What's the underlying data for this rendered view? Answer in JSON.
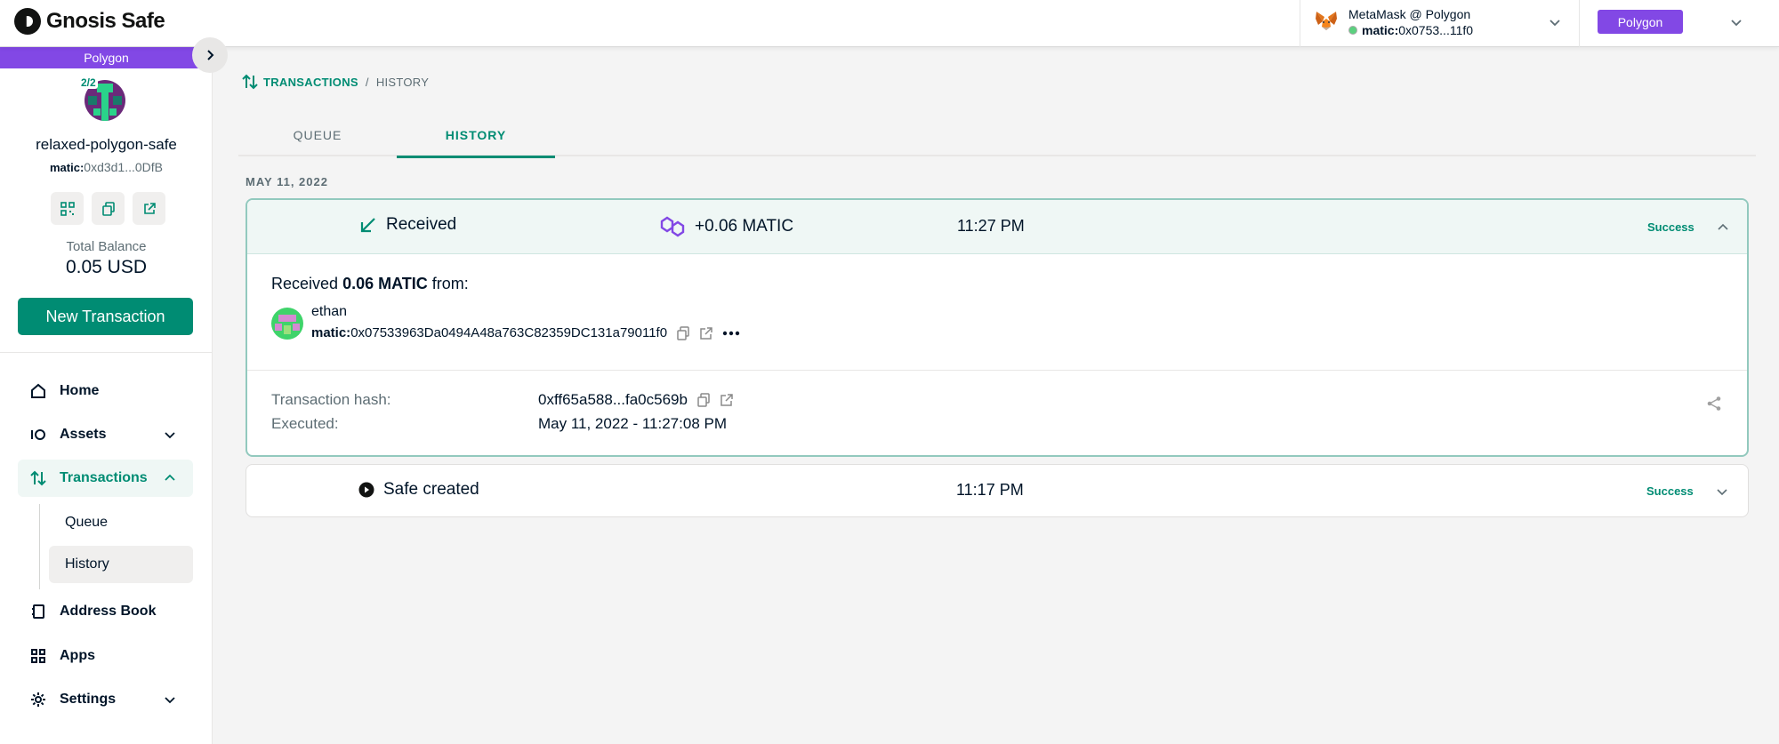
{
  "header": {
    "logo_text": "Gnosis Safe",
    "wallet_title": "MetaMask @ Polygon",
    "wallet_prefix": "matic:",
    "wallet_address": "0x0753...11f0",
    "network_button": "Polygon"
  },
  "sidebar": {
    "network_label": "Polygon",
    "threshold": "2/2",
    "safe_name": "relaxed-polygon-safe",
    "safe_prefix": "matic:",
    "safe_address": "0xd3d1...0DfB",
    "balance_label": "Total Balance",
    "balance_value": "0.05 USD",
    "new_tx_label": "New Transaction",
    "nav": {
      "home": "Home",
      "assets": "Assets",
      "transactions": "Transactions",
      "queue": "Queue",
      "history": "History",
      "address_book": "Address Book",
      "apps": "Apps",
      "settings": "Settings"
    }
  },
  "main": {
    "breadcrumb": {
      "section": "TRANSACTIONS",
      "separator": "/",
      "current": "HISTORY"
    },
    "tabs": [
      {
        "label": "QUEUE"
      },
      {
        "label": "HISTORY"
      }
    ],
    "date_group": "MAY 11, 2022",
    "transactions": [
      {
        "type": "Received",
        "amount": "+0.06 MATIC",
        "time": "11:27 PM",
        "status": "Success",
        "details": {
          "received_prefix": "Received",
          "received_amount": "0.06 MATIC",
          "received_suffix": "from:",
          "sender_name": "ethan",
          "sender_prefix": "matic:",
          "sender_address": "0x07533963Da0494A48a763C82359DC131a79011f0",
          "hash_label": "Transaction hash:",
          "hash_value": "0xff65a588...fa0c569b",
          "executed_label": "Executed:",
          "executed_value": "May 11, 2022 - 11:27:08 PM"
        }
      },
      {
        "type": "Safe created",
        "time": "11:17 PM",
        "status": "Success"
      }
    ]
  },
  "colors": {
    "brand_green": "#008c73",
    "polygon_purple": "#8248e5",
    "page_background": "#f4f4f4"
  }
}
